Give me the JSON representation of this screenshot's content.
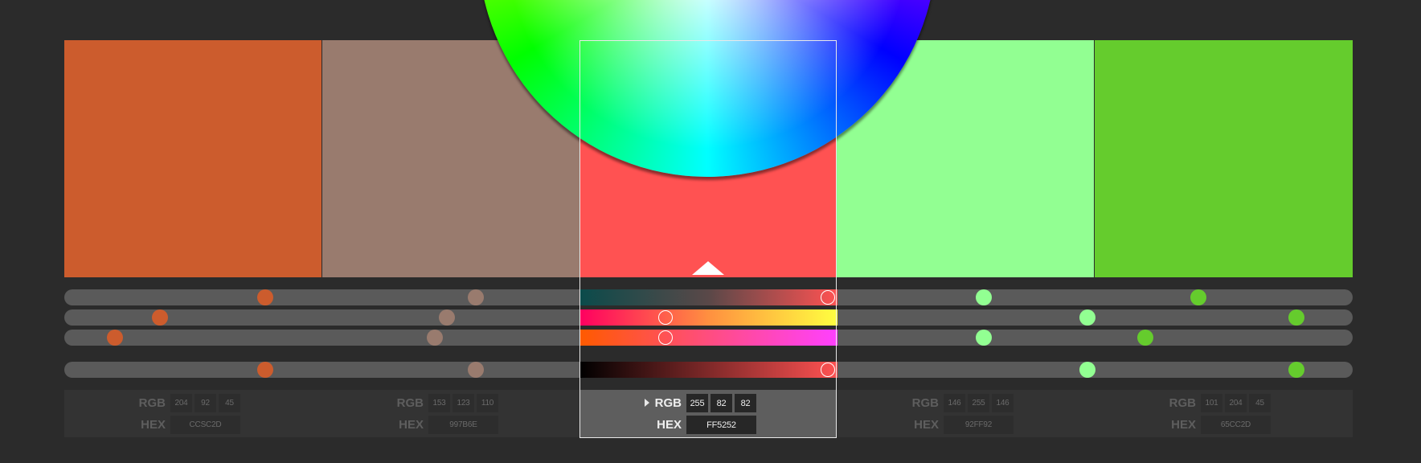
{
  "swatches": [
    {
      "hex_label": "CCSC2D",
      "rgb": [
        "204",
        "92",
        "45"
      ],
      "color": "#cc5c2d"
    },
    {
      "hex_label": "997B6E",
      "rgb": [
        "153",
        "123",
        "110"
      ],
      "color": "#997b6e"
    },
    {
      "hex_label": "FF5252",
      "rgb": [
        "255",
        "82",
        "82"
      ],
      "color": "#ff5252"
    },
    {
      "hex_label": "92FF92",
      "rgb": [
        "146",
        "255",
        "146"
      ],
      "color": "#92ff92"
    },
    {
      "hex_label": "65CC2D",
      "rgb": [
        "101",
        "204",
        "45"
      ],
      "color": "#65cc2d"
    }
  ],
  "selected_index": 2,
  "labels": {
    "rgb": "RGB",
    "hex": "HEX"
  },
  "sliders": {
    "row1": [
      0.156,
      0.319,
      0.593,
      0.732,
      0.899
    ],
    "row2": [
      0.074,
      0.297,
      0.466,
      0.794,
      0.956
    ],
    "row3": [
      0.039,
      0.288,
      0.466,
      0.717,
      0.841
    ],
    "row4": [
      0.156,
      0.319,
      0.593,
      0.794,
      0.956
    ]
  },
  "icons": {
    "expand": "caret-right-icon",
    "wheel": "color-wheel-icon",
    "selector": "triangle-pointer-icon"
  }
}
